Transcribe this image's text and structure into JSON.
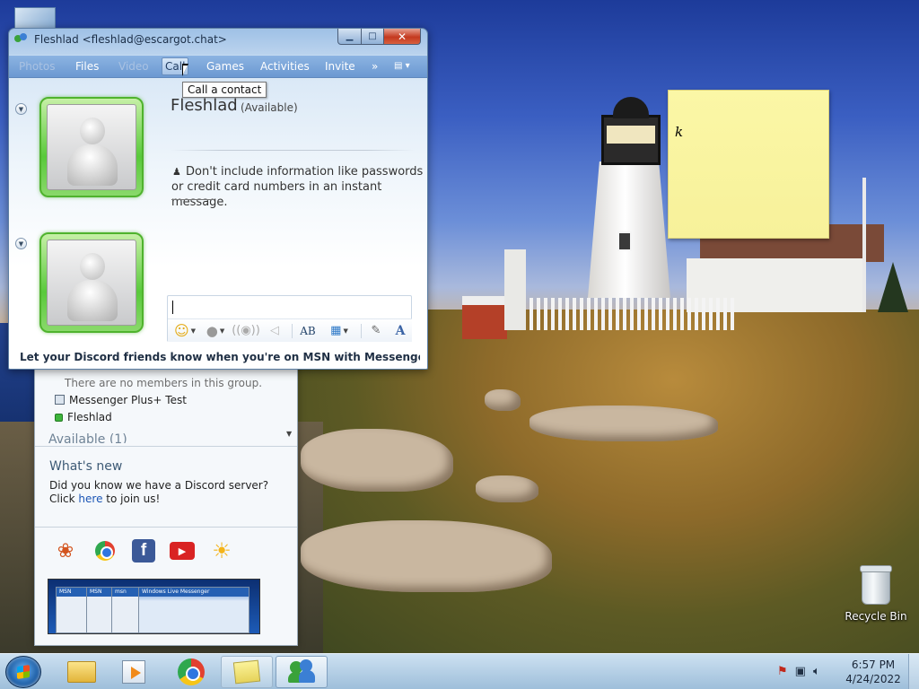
{
  "conversation": {
    "title": "Fleshlad <fleshlad@escargot.chat>",
    "menu": [
      {
        "label": "Photos",
        "state": "disabled"
      },
      {
        "label": "Files",
        "state": "normal"
      },
      {
        "label": "Video",
        "state": "disabled"
      },
      {
        "label": "Call",
        "state": "hover"
      },
      {
        "label": "Games",
        "state": "normal"
      },
      {
        "label": "Activities",
        "state": "normal"
      },
      {
        "label": "Invite",
        "state": "normal"
      },
      {
        "label": "»",
        "state": "normal"
      }
    ],
    "tooltip": "Call a contact",
    "contact_name": "Fleshlad",
    "contact_status": "(Available)",
    "warning": "Don't include information like passwords or credit card numbers in an instant message.",
    "input_value": "",
    "banner": "Let your Discord friends know when you're on MSN with Messenger Rich Pres..."
  },
  "contact_list": {
    "no_members": "There are no members in this group.",
    "contacts": [
      {
        "name": "Messenger Plus+ Test",
        "icon": "group-icon"
      },
      {
        "name": "Fleshlad",
        "icon": "online-status-icon"
      }
    ],
    "group_header": "Available (1)",
    "whats_new_title": "What's new",
    "news_text": "Did you know we have a Discord server? Click",
    "news_link": "here",
    "news_text_after": "to join us!",
    "services": [
      "msn-butterfly-icon",
      "chrome-icon",
      "facebook-icon",
      "youtube-icon",
      "weather-sun-icon"
    ]
  },
  "desktop": {
    "sticky_note_text": "k",
    "recycle_bin_label": "Recycle Bin"
  },
  "taskbar": {
    "pinned": [
      "windows-explorer-icon",
      "media-player-icon",
      "chrome-icon",
      "sticky-notes-icon",
      "messenger-icon"
    ],
    "clock_time": "6:57 PM",
    "clock_date": "4/24/2022"
  }
}
